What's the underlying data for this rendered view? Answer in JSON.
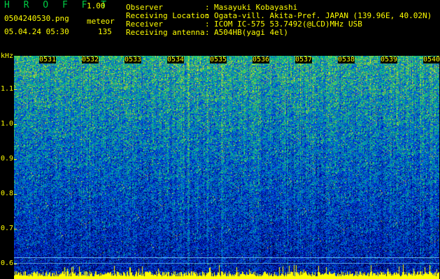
{
  "header": {
    "title": "H R O F F T",
    "version": "1.00",
    "filename": "0504240530.png",
    "mode": "meteor",
    "datetime": "05.04.24 05:30",
    "count": "135"
  },
  "info": [
    {
      "label": "Observer",
      "value": "Masayuki Kobayashi"
    },
    {
      "label": "Receiving Location",
      "value": "Ogata-vill. Akita-Pref. JAPAN (139.96E, 40.02N)"
    },
    {
      "label": "Receiver",
      "value": "ICOM IC-575 53.7492(@LCD)MHz USB"
    },
    {
      "label": "Receiving antenna",
      "value": "A504HB(yagi 4el)"
    }
  ],
  "axes": {
    "y_unit": "kHz",
    "y_ticks": [
      "1.1",
      "1.0",
      "0.9",
      "0.8",
      "0.7",
      "0.6"
    ],
    "x_ticks": [
      "0531",
      "0532",
      "0533",
      "0534",
      "0535",
      "0536",
      "0537",
      "0538",
      "0539",
      "0540"
    ]
  },
  "colors": {
    "background": "#000000",
    "label": "#ffff00",
    "title": "#00cc44",
    "spectrum_base": "#0a1a8a",
    "signal_line": "#00ffff"
  }
}
